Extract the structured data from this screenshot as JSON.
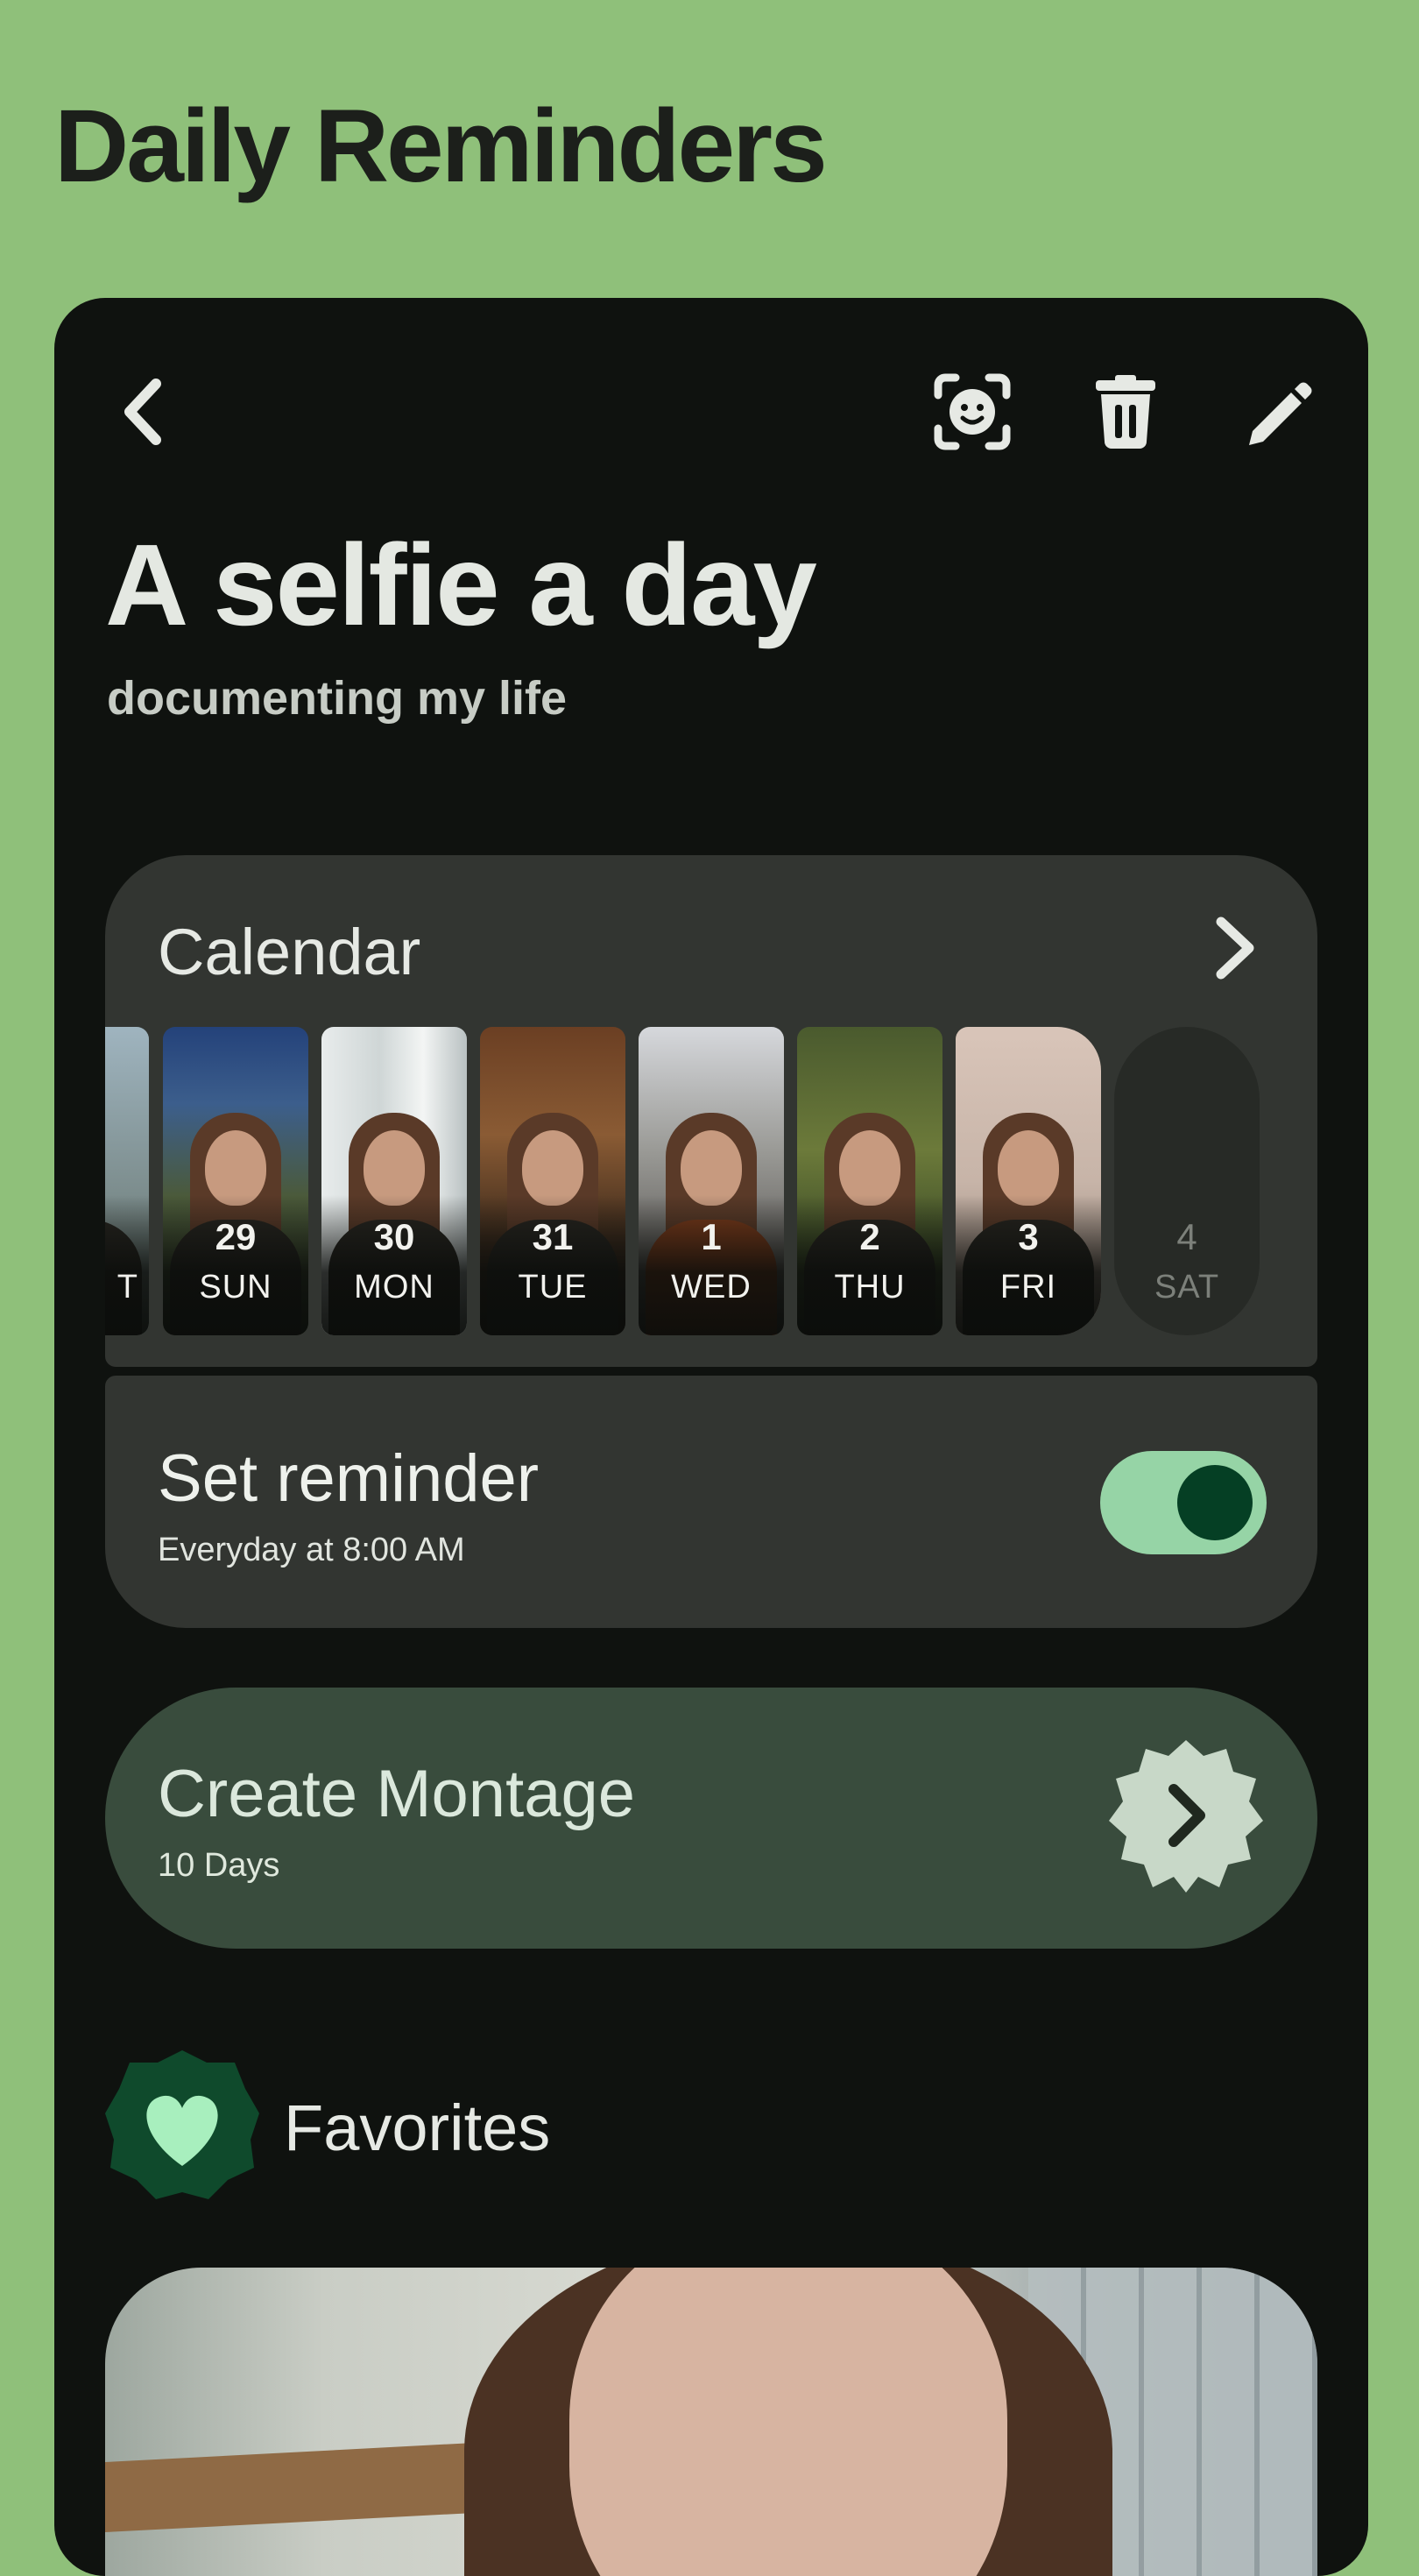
{
  "page": {
    "title": "Daily Reminders"
  },
  "header": {
    "icons": [
      "back-arrow-icon",
      "face-scan-icon",
      "trash-icon",
      "pencil-icon"
    ]
  },
  "hero": {
    "title": "A selfie a day",
    "subtitle": "documenting my life"
  },
  "calendar": {
    "title": "Calendar",
    "days": [
      {
        "num": "",
        "dow": "T",
        "has_photo": true
      },
      {
        "num": "29",
        "dow": "SUN",
        "has_photo": true
      },
      {
        "num": "30",
        "dow": "MON",
        "has_photo": true
      },
      {
        "num": "31",
        "dow": "TUE",
        "has_photo": true
      },
      {
        "num": "1",
        "dow": "WED",
        "has_photo": true
      },
      {
        "num": "2",
        "dow": "THU",
        "has_photo": true
      },
      {
        "num": "3",
        "dow": "FRI",
        "has_photo": true
      },
      {
        "num": "4",
        "dow": "SAT",
        "has_photo": false
      }
    ]
  },
  "reminder": {
    "title": "Set reminder",
    "subtitle": "Everyday at 8:00 AM",
    "enabled": true
  },
  "montage": {
    "title": "Create Montage",
    "subtitle": "10 Days"
  },
  "favorites": {
    "label": "Favorites"
  },
  "colors": {
    "background": "#8fc07a",
    "surface": "#0f120f",
    "card": "#323531",
    "montage_card": "#394c3d",
    "toggle_track": "#96d4a6",
    "toggle_knob": "#053f24",
    "favorites_badge": "#0f4a2c",
    "favorites_heart": "#a8efbe"
  }
}
